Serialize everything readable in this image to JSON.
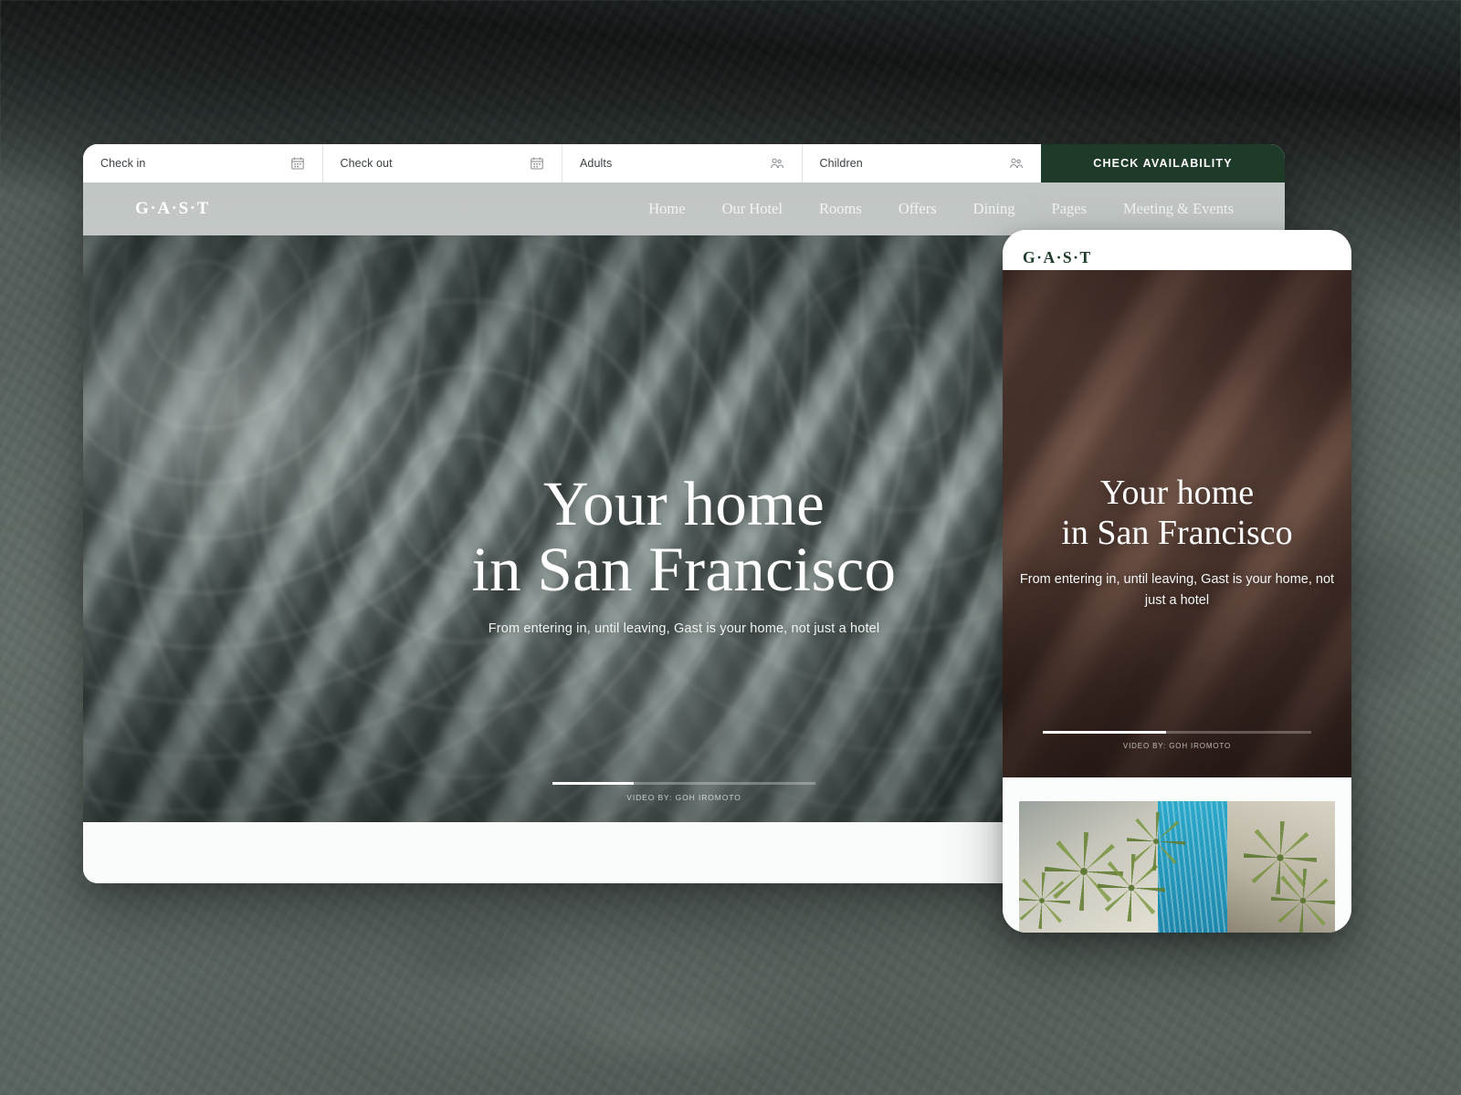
{
  "page": {
    "title": "GAST Hotel — Responsive Website Mockup",
    "background_color": "#5b6561"
  },
  "desktop": {
    "booking_bar": {
      "fields": [
        {
          "label": "Check in",
          "icon": "calendar-icon",
          "name": "checkin"
        },
        {
          "label": "Check out",
          "icon": "calendar-icon",
          "name": "checkout"
        },
        {
          "label": "Adults",
          "icon": "people-icon",
          "name": "adults"
        },
        {
          "label": "Children",
          "icon": "people-icon",
          "name": "children"
        }
      ],
      "cta_label": "CHECK AVAILABILITY",
      "cta_color": "#1e3b29"
    },
    "nav": {
      "logo": "G·A·S·T",
      "items": [
        {
          "label": "Home"
        },
        {
          "label": "Our Hotel"
        },
        {
          "label": "Rooms"
        },
        {
          "label": "Offers"
        },
        {
          "label": "Dining"
        },
        {
          "label": "Pages"
        },
        {
          "label": "Meeting & Events"
        }
      ]
    },
    "hero": {
      "heading_line1": "Your home",
      "heading_line2": "in San Francisco",
      "subtitle": "From entering in, until leaving, Gast is your home, not just a hotel",
      "credit": "VIDEO BY: GOH IROMOTO",
      "progress_percent": 31
    }
  },
  "mobile": {
    "logo": "G·A·S·T",
    "logo_color": "#1e3b29",
    "hero": {
      "heading_line1": "Your home",
      "heading_line2": "in San Francisco",
      "subtitle_line1": "From entering in, until leaving, Gast is",
      "subtitle_line2": "your home, not just a hotel",
      "credit": "VIDEO BY: GOH IROMOTO",
      "progress_percent": 46
    },
    "gallery": {
      "alt": "aerial-pool-palm-trees-photo"
    }
  }
}
